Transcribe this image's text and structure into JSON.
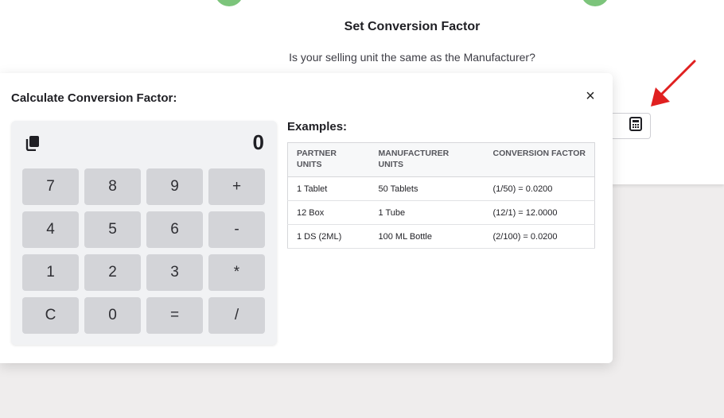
{
  "background": {
    "title": "Set Conversion Factor",
    "question": "Is your selling unit the same as the Manufacturer?",
    "calculator_button_icon": "calculator-icon",
    "arrow_color": "#e02020"
  },
  "modal": {
    "title": "Calculate Conversion Factor:",
    "close_label": "×"
  },
  "calculator": {
    "copy_icon": "copy-icon",
    "display": "0",
    "keys": [
      "7",
      "8",
      "9",
      "+",
      "4",
      "5",
      "6",
      "-",
      "1",
      "2",
      "3",
      "*",
      "C",
      "0",
      "=",
      "/"
    ]
  },
  "examples": {
    "title": "Examples:",
    "headers": [
      "PARTNER UNITS",
      "MANUFACTURER UNITS",
      "CONVERSION FACTOR"
    ],
    "rows": [
      [
        "1 Tablet",
        "50 Tablets",
        "(1/50) = 0.0200"
      ],
      [
        "12 Box",
        "1 Tube",
        "(12/1) = 12.0000"
      ],
      [
        "1 DS (2ML)",
        "100 ML Bottle",
        "(2/100) = 0.0200"
      ]
    ]
  },
  "colors": {
    "step_green": "#7cc47b",
    "key_bg": "#d3d4d8",
    "calc_bg": "#f1f2f4"
  }
}
